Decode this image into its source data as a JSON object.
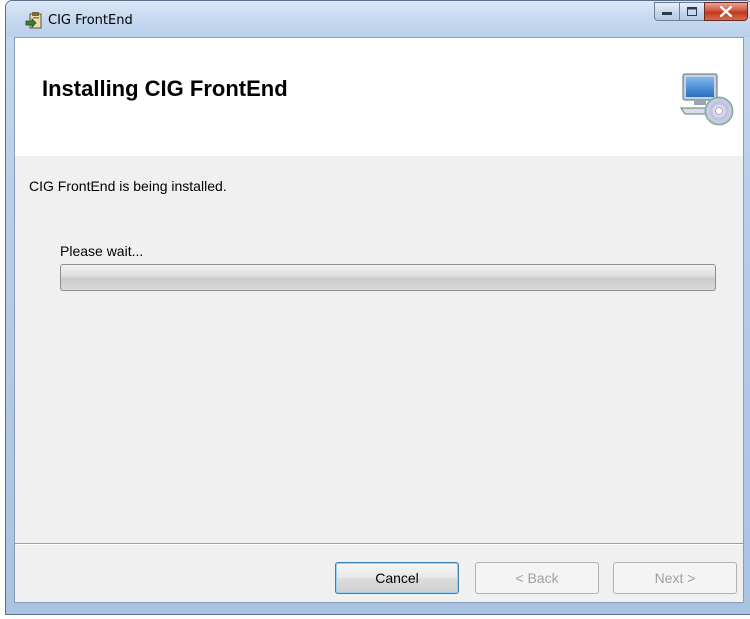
{
  "window": {
    "title": "CIG FrontEnd"
  },
  "banner": {
    "title": "Installing CIG FrontEnd"
  },
  "body": {
    "description": "CIG FrontEnd is being installed.",
    "status": "Please wait...",
    "progress": 0
  },
  "buttons": {
    "cancel": "Cancel",
    "back": "< Back",
    "next": "Next >"
  },
  "icons": {
    "app": "installer-icon",
    "banner": "computer-cd-icon",
    "minimize": "minimize-icon",
    "maximize": "maximize-icon",
    "close": "close-icon"
  },
  "colors": {
    "close_button": "#c0391f",
    "banner_bg": "#ffffff",
    "client_bg": "#f0f0f0"
  }
}
